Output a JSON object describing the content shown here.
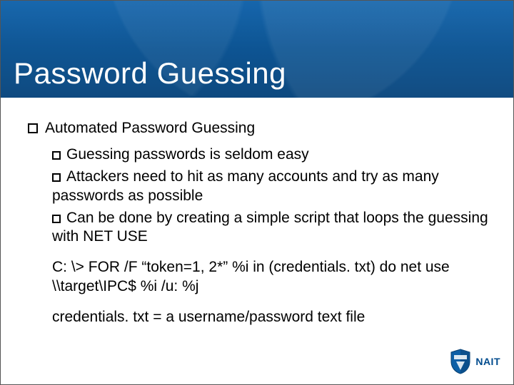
{
  "title": "Password Guessing",
  "bullets": {
    "l1": "Automated Password Guessing",
    "s1": "Guessing passwords is seldom easy",
    "s2": "Attackers need to hit as many accounts and try as many passwords as possible",
    "s3": "Can be done by creating a simple script that loops the guessing with NET USE",
    "code": "C: \\> FOR /F “token=1, 2*” %i in (credentials. txt) do net use \\\\target\\IPC$ %i /u: %j",
    "note": "credentials. txt = a username/password text file"
  },
  "brand": "NAIT"
}
